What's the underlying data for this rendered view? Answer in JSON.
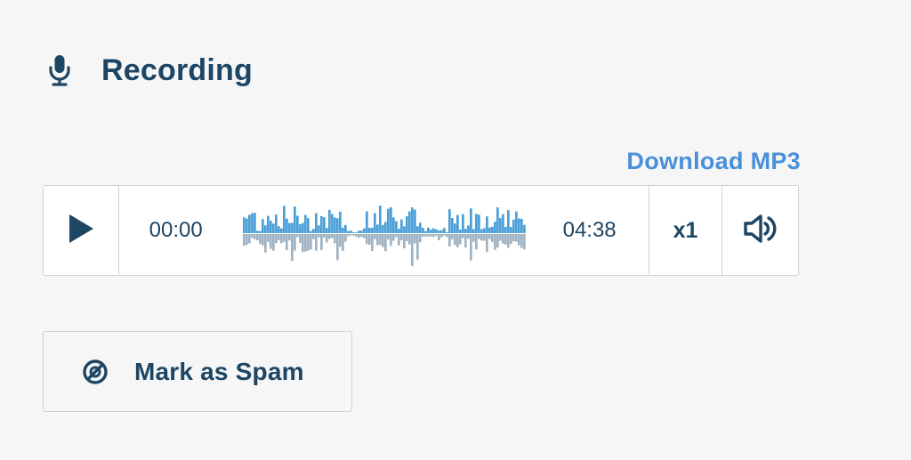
{
  "section": {
    "title": "Recording",
    "icon": "microphone-icon"
  },
  "download": {
    "label": "Download MP3"
  },
  "player": {
    "play_icon": "play-icon",
    "current_time": "00:00",
    "duration": "04:38",
    "speed_label": "x1",
    "volume_icon": "volume-icon",
    "colors": {
      "played_wave": "#4a9fd8",
      "unplayed_wave": "#9fb3c3",
      "accent": "#1d4564"
    }
  },
  "spam": {
    "label": "Mark as Spam",
    "icon": "spam-block-icon"
  }
}
